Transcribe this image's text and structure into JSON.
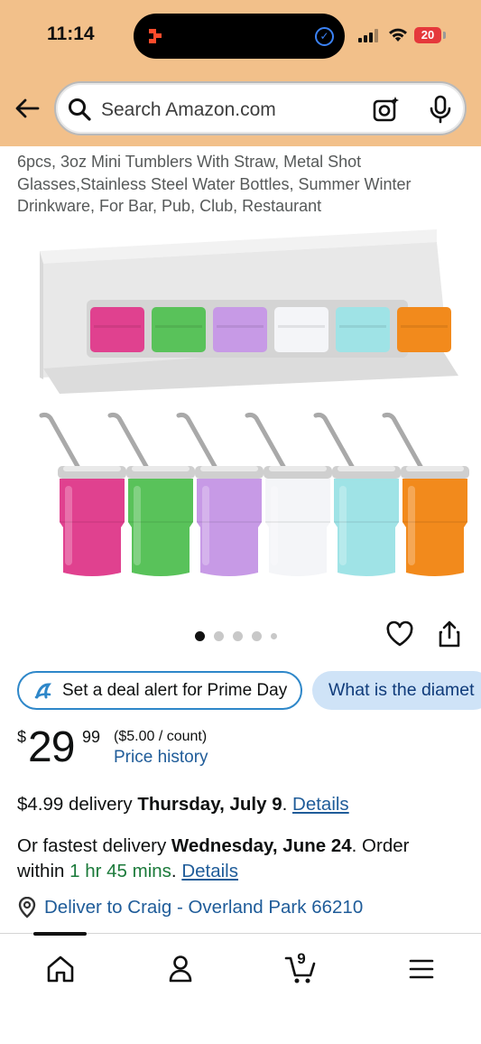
{
  "status_bar": {
    "time": "11:14",
    "battery": "20"
  },
  "search": {
    "placeholder": "Search Amazon.com"
  },
  "product": {
    "title": "6pcs, 3oz Mini Tumblers With Straw, Metal Shot Glasses,Stainless Steel Water Bottles, Summer Winter Drinkware, For Bar, Pub, Club, Restaurant",
    "tumbler_colors": [
      "#e0418f",
      "#59c25a",
      "#c79ae6",
      "#f4f5f8",
      "#9fe3e6",
      "#f28a1c"
    ],
    "image_count": 5,
    "active_image": 1
  },
  "chips": {
    "deal_alert": "Set a deal alert for Prime Day",
    "question": "What is the diamet"
  },
  "price": {
    "symbol": "$",
    "whole": "29",
    "fraction": "99",
    "unit_price": "($5.00 / count)",
    "history_label": "Price history"
  },
  "delivery": {
    "cost": "$4.99 delivery ",
    "date": "Thursday, July 9",
    "after_date": ". ",
    "details": "Details",
    "fastest_prefix": "Or fastest delivery ",
    "fastest_date": "Wednesday, June 24",
    "order_within": ". Order within ",
    "countdown": "1 hr 45 mins",
    "after_countdown": ". ",
    "fastest_details": "Details",
    "deliver_to": "Deliver to Craig - Overland Park 66210"
  },
  "nav": {
    "cart_count": "9"
  },
  "colors": {
    "header": "#f2c08a",
    "link": "#1f5c99",
    "accent_blue": "#2e87c9",
    "green": "#1b7a3a"
  }
}
